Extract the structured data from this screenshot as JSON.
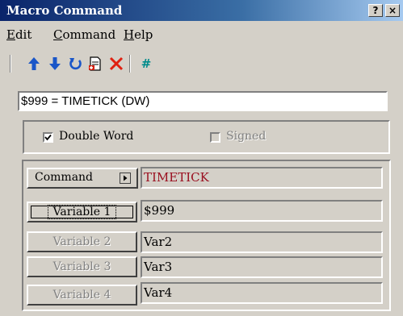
{
  "window": {
    "title": "Macro Command",
    "help_glyph": "?",
    "close_glyph": "×"
  },
  "menu": [
    {
      "accel": "E",
      "rest": "dit"
    },
    {
      "accel": "C",
      "rest": "ommand"
    },
    {
      "accel": "H",
      "rest": "elp"
    }
  ],
  "toolbar": {
    "icons": [
      "move-up-icon",
      "move-down-icon",
      "undo-icon",
      "new-page-icon",
      "delete-icon",
      "hash-icon"
    ],
    "hash_glyph": "#"
  },
  "expression": "$999 = TIMETICK (DW)",
  "options": {
    "double_word": {
      "label": "Double Word",
      "checked": true
    },
    "signed": {
      "label": "Signed",
      "checked": false,
      "enabled": false
    }
  },
  "command": {
    "button_label": "Command",
    "value": "TIMETICK"
  },
  "variables": [
    {
      "label": "Variable 1",
      "value": "$999",
      "enabled": true
    },
    {
      "label": "Variable 2",
      "value": "Var2",
      "enabled": false
    },
    {
      "label": "Variable 3",
      "value": "Var3",
      "enabled": false
    },
    {
      "label": "Variable 4",
      "value": "Var4",
      "enabled": false
    }
  ],
  "colors": {
    "title_start": "#0a246a",
    "title_end": "#a6caf0",
    "command_text": "#9a1020",
    "toolbar_blue": "#1a56c8",
    "delete_red": "#e02010",
    "hash_teal": "#008b8b"
  }
}
